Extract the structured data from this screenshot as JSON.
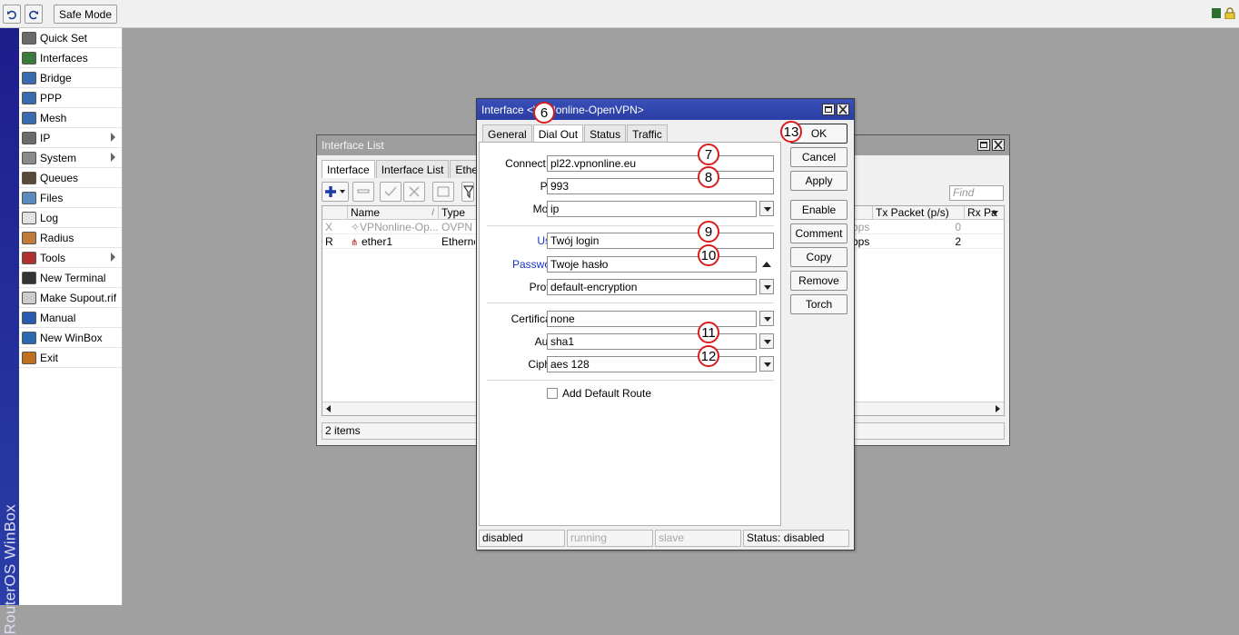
{
  "toolbar": {
    "safe_mode_label": "Safe Mode"
  },
  "brand": {
    "text": "RouterOS WinBox"
  },
  "sidebar": {
    "items": [
      {
        "label": "Quick Set",
        "icon": "quick-set-icon",
        "submenu": false
      },
      {
        "label": "Interfaces",
        "icon": "interfaces-icon",
        "submenu": false
      },
      {
        "label": "Bridge",
        "icon": "bridge-icon",
        "submenu": false
      },
      {
        "label": "PPP",
        "icon": "ppp-icon",
        "submenu": false
      },
      {
        "label": "Mesh",
        "icon": "mesh-icon",
        "submenu": false
      },
      {
        "label": "IP",
        "icon": "ip-icon",
        "submenu": true
      },
      {
        "label": "System",
        "icon": "system-icon",
        "submenu": true
      },
      {
        "label": "Queues",
        "icon": "queues-icon",
        "submenu": false
      },
      {
        "label": "Files",
        "icon": "files-icon",
        "submenu": false
      },
      {
        "label": "Log",
        "icon": "log-icon",
        "submenu": false
      },
      {
        "label": "Radius",
        "icon": "radius-icon",
        "submenu": false
      },
      {
        "label": "Tools",
        "icon": "tools-icon",
        "submenu": true
      },
      {
        "label": "New Terminal",
        "icon": "terminal-icon",
        "submenu": false
      },
      {
        "label": "Make Supout.rif",
        "icon": "supout-icon",
        "submenu": false
      },
      {
        "label": "Manual",
        "icon": "manual-icon",
        "submenu": false
      },
      {
        "label": "New WinBox",
        "icon": "winbox-icon",
        "submenu": false
      },
      {
        "label": "Exit",
        "icon": "exit-icon",
        "submenu": false
      }
    ]
  },
  "interface_list": {
    "title": "Interface List",
    "tabs": [
      "Interface",
      "Interface List",
      "Ethernet"
    ],
    "find_placeholder": "Find",
    "columns": {
      "name": "Name",
      "sort": "/",
      "type": "Type",
      "tx_packet": "Tx Packet (p/s)",
      "rx_packet": "Rx Pa"
    },
    "rows": [
      {
        "flag": "X",
        "name": "✧VPNonline-Op...",
        "type": "OVPN C",
        "rate": "bps",
        "tx": "0"
      },
      {
        "flag": "R",
        "name": "ether1",
        "type": "Ethernet",
        "rate": "bps",
        "tx": "2"
      }
    ],
    "status": "2 items"
  },
  "dialog": {
    "title": "Interface <VPNonline-OpenVPN>",
    "tabs": [
      "General",
      "Dial Out",
      "Status",
      "Traffic"
    ],
    "fields": {
      "connect_to": {
        "label": "Connect To:",
        "value": "pl22.vpnonline.eu"
      },
      "port": {
        "label": "Port:",
        "value": "993"
      },
      "mode": {
        "label": "Mode:",
        "value": "ip"
      },
      "user": {
        "label": "User:",
        "value": "Twój login"
      },
      "password": {
        "label": "Password:",
        "value": "Twoje hasło"
      },
      "profile": {
        "label": "Profile:",
        "value": "default-encryption"
      },
      "certificate": {
        "label": "Certificate:",
        "value": "none"
      },
      "auth": {
        "label": "Auth.:",
        "value": "sha1"
      },
      "cipher": {
        "label": "Cipher:",
        "value": "aes 128"
      }
    },
    "add_default_route": {
      "label": "Add Default Route",
      "checked": false
    },
    "buttons": {
      "ok": "OK",
      "cancel": "Cancel",
      "apply": "Apply",
      "enable": "Enable",
      "comment": "Comment",
      "copy": "Copy",
      "remove": "Remove",
      "torch": "Torch"
    },
    "status": {
      "s1": "disabled",
      "s2": "running",
      "s3": "slave",
      "s4": "Status: disabled"
    }
  },
  "annotations": [
    "6",
    "7",
    "8",
    "9",
    "10",
    "11",
    "12",
    "13"
  ],
  "colors": {
    "title_active": "#2a3ea5",
    "annotation_ring": "#d81d1d",
    "label_blue": "#1a32c8"
  }
}
